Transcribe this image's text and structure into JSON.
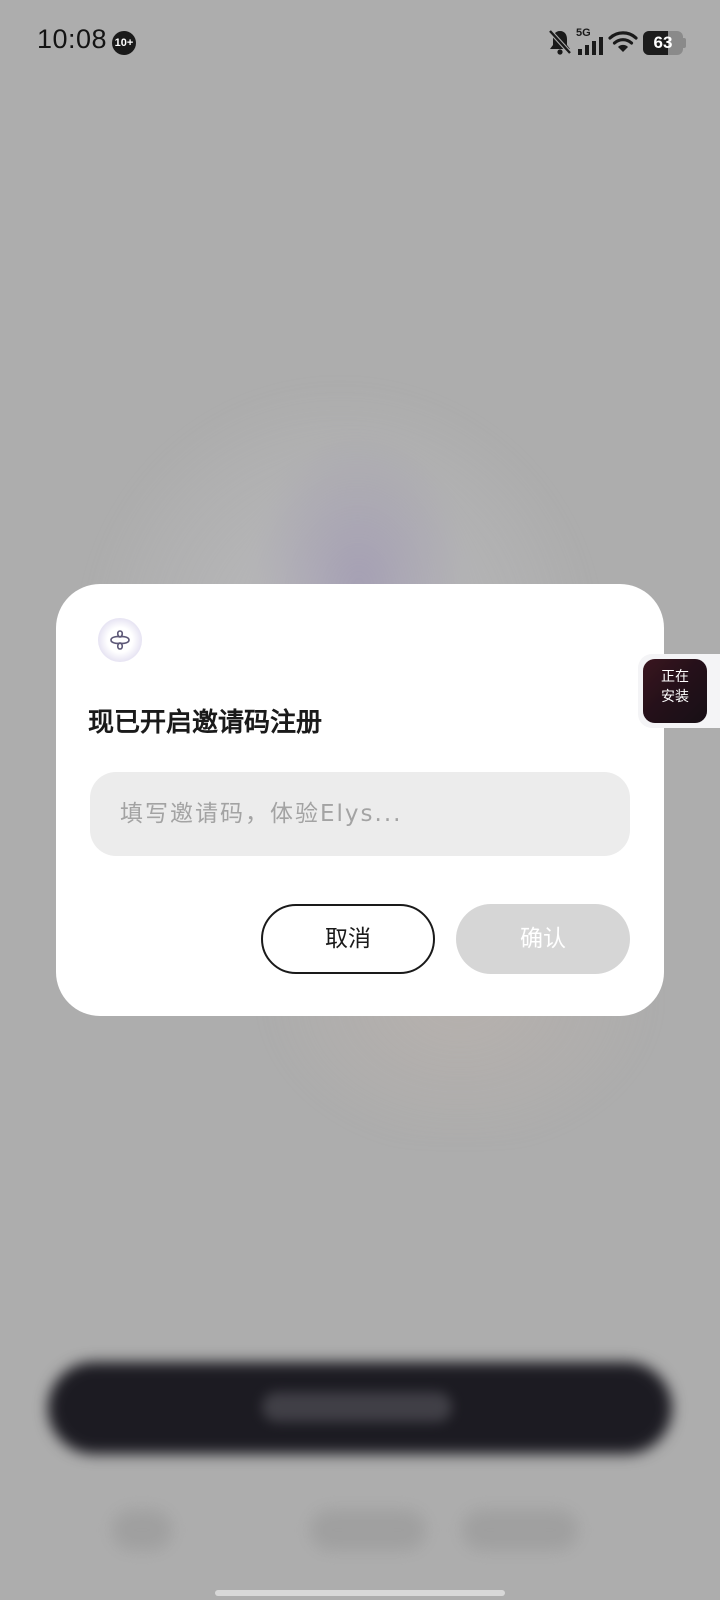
{
  "status_bar": {
    "time": "10:08",
    "notification_badge": "10+",
    "network": "5G",
    "battery_level": "63",
    "battery_percent": 63
  },
  "dialog": {
    "title": "现已开启邀请码注册",
    "invite_input": {
      "value": "",
      "placeholder": "填写邀请码，体验Elys..."
    },
    "cancel_label": "取消",
    "confirm_label": "确认"
  },
  "install_widget": {
    "label_line1": "正在",
    "label_line2": "安装"
  },
  "colors": {
    "scrim": "#adadad",
    "dialog_bg": "#ffffff",
    "input_bg": "#ececec",
    "confirm_disabled": "#d6d6d6",
    "text_primary": "#1a1a1a"
  },
  "icons": {
    "app_logo": "elys-clover-icon",
    "mute": "bell-off-icon",
    "signal": "cellular-signal-icon",
    "wifi": "wifi-icon",
    "battery": "battery-icon"
  }
}
